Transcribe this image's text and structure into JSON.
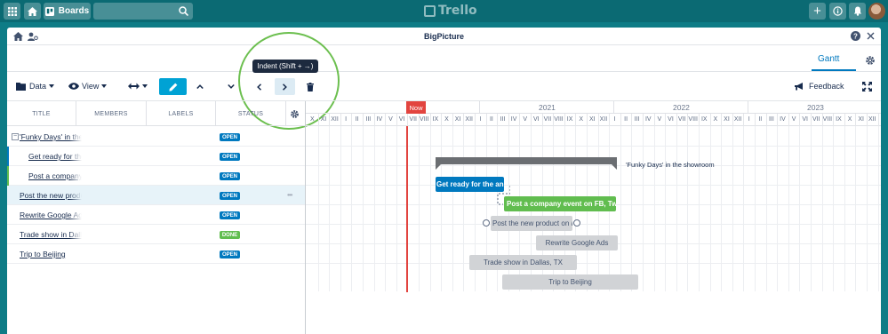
{
  "topbar": {
    "boards_label": "Boards",
    "logo_text": "Trello",
    "icons": [
      "apps-icon",
      "home-icon",
      "boards-icon",
      "search-icon",
      "plus-icon",
      "info-icon",
      "bell-icon",
      "avatar"
    ]
  },
  "window": {
    "title": "BigPicture",
    "tab": "Gantt"
  },
  "toolbar": {
    "data_label": "Data",
    "view_label": "View",
    "tooltip": "Indent (Shift + →)",
    "feedback_label": "Feedback"
  },
  "grid": {
    "columns": [
      "TITLE",
      "MEMBERS",
      "LABELS",
      "STATUS"
    ],
    "rows": [
      {
        "title": "'Funky Days' in the showroom",
        "status": "OPEN",
        "status_color": "#0079bf",
        "bar_color": ""
      },
      {
        "title": "Get ready for the annual",
        "status": "OPEN",
        "status_color": "#0079bf",
        "bar_color": "#0079bf"
      },
      {
        "title": "Post a company event on FB",
        "status": "OPEN",
        "status_color": "#0079bf",
        "bar_color": "#61bd4f"
      },
      {
        "title": "Post the new product on a",
        "status": "OPEN",
        "status_color": "#0079bf",
        "bar_color": ""
      },
      {
        "title": "Rewrite Google Ads",
        "status": "OPEN",
        "status_color": "#0079bf",
        "bar_color": ""
      },
      {
        "title": "Trade show in Dallas",
        "status": "DONE",
        "status_color": "#61bd4f",
        "bar_color": ""
      },
      {
        "title": "Trip to Beijing",
        "status": "OPEN",
        "status_color": "#0079bf",
        "bar_color": ""
      }
    ],
    "more_label": "•••"
  },
  "timeline": {
    "now_label": "Now",
    "years": [
      "2021",
      "2022",
      "2023"
    ],
    "months": [
      "X",
      "XI",
      "XII",
      "I",
      "II",
      "III",
      "IV",
      "V",
      "VI",
      "VII",
      "VIII",
      "IX",
      "X",
      "XI",
      "XII",
      "I",
      "II",
      "III",
      "IV",
      "V",
      "VI",
      "VII",
      "VIII",
      "IX",
      "X",
      "XI",
      "XII",
      "I",
      "II",
      "III",
      "IV",
      "V",
      "VI",
      "VII",
      "VIII",
      "IX",
      "X",
      "XI",
      "XII",
      "I",
      "II",
      "III",
      "IV",
      "V",
      "VI",
      "VII",
      "VIII",
      "IX",
      "X",
      "XI",
      "XII"
    ],
    "summary_label": "'Funky Days' in the showroom",
    "bars": [
      {
        "label": "Get ready for the annu",
        "style": "blue"
      },
      {
        "label": "Post a company event on FB, Twitter a",
        "style": "green"
      },
      {
        "label": "Post the new product on a v",
        "style": "grey"
      },
      {
        "label": "Rewrite Google Ads",
        "style": "grey"
      },
      {
        "label": "Trade show in Dallas, TX",
        "style": "grey"
      },
      {
        "label": "Trip to Beijing",
        "style": "grey"
      }
    ]
  }
}
